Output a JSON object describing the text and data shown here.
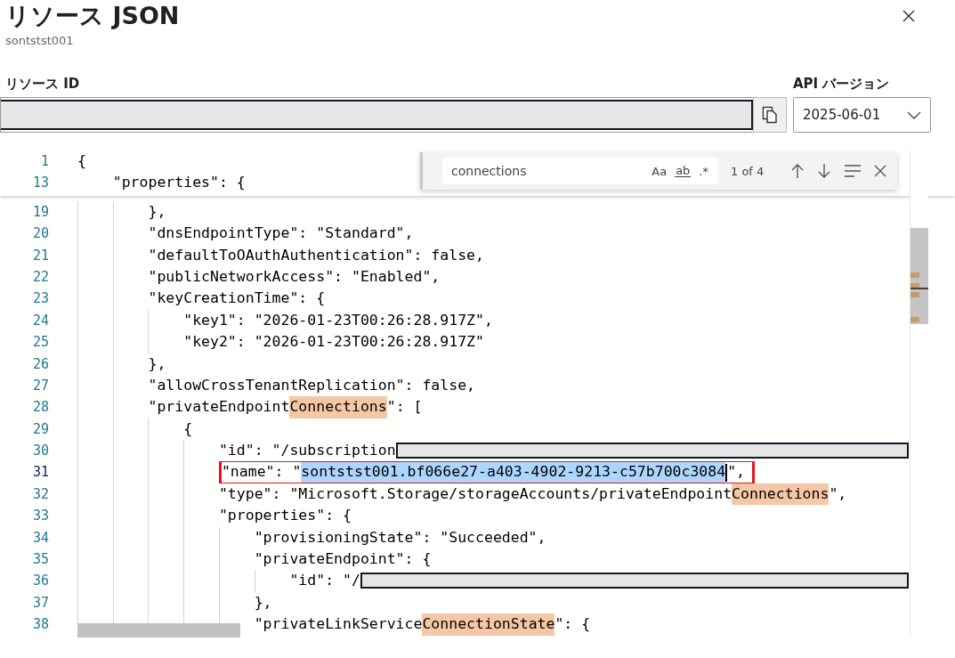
{
  "dialog": {
    "title": "リソース JSON",
    "subtitle": "sontstst001"
  },
  "resource_id": {
    "label": "リソース ID",
    "redacted": true
  },
  "api_version": {
    "label": "API バージョン",
    "value": "2025-06-01"
  },
  "find": {
    "query": "connections",
    "count": "1 of 4",
    "options": [
      {
        "label": "Aa",
        "kind": "case",
        "on": false
      },
      {
        "label": "ab",
        "kind": "word",
        "on": false
      },
      {
        "label": ".*",
        "kind": "regex",
        "on": false
      }
    ]
  },
  "editor": {
    "sticky_lines": [
      {
        "number": "1",
        "segments": [
          {
            "text": "{",
            "kind": "text"
          }
        ],
        "children": [
          {
            "number": "13",
            "segments": [
              {
                "text": "\"properties\": {",
                "kind": "text"
              }
            ]
          }
        ]
      }
    ],
    "lines": [
      {
        "number": "19",
        "current": false,
        "segments": [
          {
            "text": "},",
            "kind": "text"
          }
        ]
      },
      {
        "number": "20",
        "current": false,
        "segments": [
          {
            "text": "\"dnsEndpointType\": \"Standard\",",
            "kind": "text"
          }
        ]
      },
      {
        "number": "21",
        "current": false,
        "segments": [
          {
            "text": "\"defaultToOAuthAuthentication\": false,",
            "kind": "text"
          }
        ]
      },
      {
        "number": "22",
        "current": false,
        "segments": [
          {
            "text": "\"publicNetworkAccess\": \"Enabled\",",
            "kind": "text"
          }
        ]
      },
      {
        "number": "23",
        "current": false,
        "segments": [
          {
            "text": "\"keyCreationTime\": {",
            "kind": "text"
          }
        ],
        "children": [
          {
            "number": "24",
            "current": false,
            "segments": [
              {
                "text": "\"key1\": \"2026-01-23T00:26:28.917Z\",",
                "kind": "text"
              }
            ]
          },
          {
            "number": "25",
            "current": false,
            "segments": [
              {
                "text": "\"key2\": \"2026-01-23T00:26:28.917Z\"",
                "kind": "text"
              }
            ]
          }
        ]
      },
      {
        "number": "26",
        "current": false,
        "segments": [
          {
            "text": "},",
            "kind": "text"
          }
        ]
      },
      {
        "number": "27",
        "current": false,
        "segments": [
          {
            "text": "\"allowCrossTenantReplication\": false,",
            "kind": "text"
          }
        ]
      },
      {
        "number": "28",
        "current": false,
        "segments": [
          {
            "text": "\"privateEndpoint",
            "kind": "text"
          },
          {
            "text": "Connections",
            "kind": "match"
          },
          {
            "text": "\": [",
            "kind": "text"
          }
        ],
        "children": [
          {
            "number": "29",
            "current": false,
            "segments": [
              {
                "text": "{",
                "kind": "text"
              }
            ],
            "children": [
              {
                "number": "30",
                "current": false,
                "redacted": true,
                "segments": [
                  {
                    "text": "\"id\": \"/subscription",
                    "kind": "text"
                  }
                ]
              },
              {
                "number": "31",
                "current": true,
                "boxed": true,
                "segments": [
                  {
                    "text": "\"name\": \"",
                    "kind": "text"
                  },
                  {
                    "text": "sontstst001.bf066e27-a403-4902-9213-c57b700c3084",
                    "kind": "selection",
                    "caret": true
                  },
                  {
                    "text": "\",",
                    "kind": "text"
                  }
                ]
              },
              {
                "number": "32",
                "current": false,
                "segments": [
                  {
                    "text": "\"type\": \"Microsoft.Storage/storageAccounts/privateEndpoint",
                    "kind": "text"
                  },
                  {
                    "text": "Connections",
                    "kind": "match"
                  },
                  {
                    "text": "\",",
                    "kind": "text"
                  }
                ]
              },
              {
                "number": "33",
                "current": false,
                "segments": [
                  {
                    "text": "\"properties\": {",
                    "kind": "text"
                  }
                ],
                "children": [
                  {
                    "number": "34",
                    "current": false,
                    "segments": [
                      {
                        "text": "\"provisioningState\": \"Succeeded\",",
                        "kind": "text"
                      }
                    ]
                  },
                  {
                    "number": "35",
                    "current": false,
                    "segments": [
                      {
                        "text": "\"privateEndpoint\": {",
                        "kind": "text"
                      }
                    ],
                    "children": [
                      {
                        "number": "36",
                        "current": false,
                        "redacted": true,
                        "segments": [
                          {
                            "text": "\"id\": \"/",
                            "kind": "text"
                          }
                        ]
                      }
                    ]
                  },
                  {
                    "number": "37",
                    "current": false,
                    "segments": [
                      {
                        "text": "},",
                        "kind": "text"
                      }
                    ]
                  },
                  {
                    "number": "38",
                    "current": false,
                    "segments": [
                      {
                        "text": "\"privateLinkService",
                        "kind": "text"
                      },
                      {
                        "text": "ConnectionState",
                        "kind": "match"
                      },
                      {
                        "text": "\": {",
                        "kind": "text"
                      }
                    ]
                  }
                ]
              }
            ]
          }
        ]
      }
    ]
  }
}
